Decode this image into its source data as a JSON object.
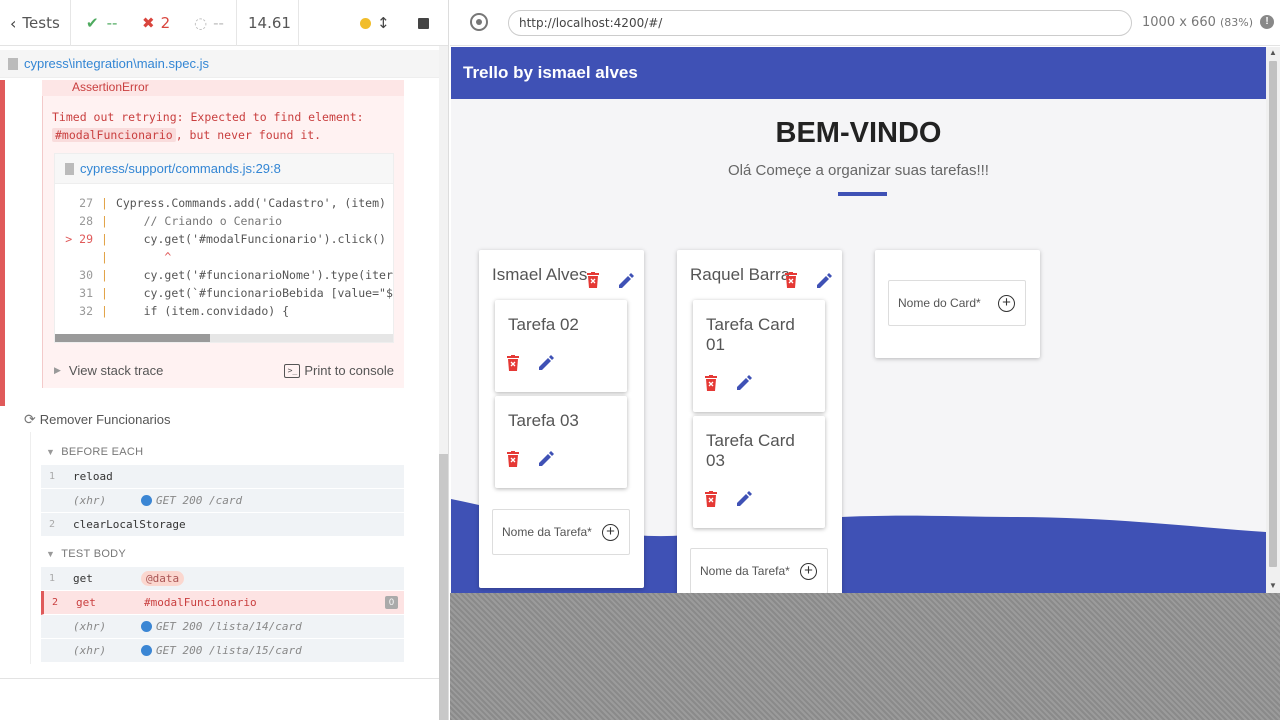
{
  "stats": {
    "tests_label": "Tests",
    "passed": "--",
    "failed": "2",
    "pending": "--",
    "duration": "14.61"
  },
  "spec": {
    "path": "cypress\\integration\\main.spec.js"
  },
  "error": {
    "header": "AssertionError",
    "message_line1": "Timed out retrying: Expected to find element:",
    "message_selector": "#modalFuncionario",
    "message_rest": ", but never found it.",
    "code_file": "cypress/support/commands.js:29:8",
    "code_lines": [
      {
        "num": "27",
        "text": "Cypress.Commands.add('Cadastro', (item)"
      },
      {
        "num": "28",
        "text": "    // Criando o Cenario"
      },
      {
        "num": "> 29",
        "text": "    cy.get('#modalFuncionario').click()"
      },
      {
        "num": "",
        "text": "       ^"
      },
      {
        "num": "30",
        "text": "    cy.get('#funcionarioNome').type(iter"
      },
      {
        "num": "31",
        "text": "    cy.get(`#funcionarioBebida [value=\"$"
      },
      {
        "num": "32",
        "text": "    if (item.convidado) {"
      }
    ],
    "view_stack_trace": "View stack trace",
    "print_to_console": "Print to console"
  },
  "suite": {
    "title": "Remover Funcionarios",
    "before_each_label": "BEFORE EACH",
    "test_body_label": "TEST BODY",
    "before_each": [
      {
        "num": "1",
        "name": "reload",
        "msg": ""
      },
      {
        "num": "",
        "name": "(xhr)",
        "msg": "GET 200 /card"
      },
      {
        "num": "2",
        "name": "clearLocalStorage",
        "msg": ""
      }
    ],
    "test_body": [
      {
        "num": "1",
        "name": "get",
        "msg": "@data"
      },
      {
        "num": "2",
        "name": "get",
        "msg": "#modalFuncionario",
        "badge": "0"
      },
      {
        "num": "",
        "name": "(xhr)",
        "msg": "GET 200 /lista/14/card"
      },
      {
        "num": "",
        "name": "(xhr)",
        "msg": "GET 200 /lista/15/card"
      }
    ]
  },
  "runner": {
    "url": "http://localhost:4200/#/",
    "viewport": "1000 x 660",
    "scale": "(83%)"
  },
  "app": {
    "nav_title": "Trello by ismael alves",
    "hero_title": "BEM-VINDO",
    "hero_subtitle": "Olá Começe a organizar suas tarefas!!!",
    "lists": [
      {
        "title": "Ismael Alves",
        "cards": [
          "Tarefa 02",
          "Tarefa 03"
        ],
        "add_placeholder": "Nome da Tarefa*"
      },
      {
        "title": "Raquel Barra",
        "cards": [
          "Tarefa Card 01",
          "Tarefa Card 03"
        ],
        "add_placeholder": "Nome da Tarefa*"
      }
    ],
    "new_card_placeholder": "Nome do Card*",
    "colors": {
      "primary": "#3f51b5",
      "danger": "#e53935"
    }
  }
}
